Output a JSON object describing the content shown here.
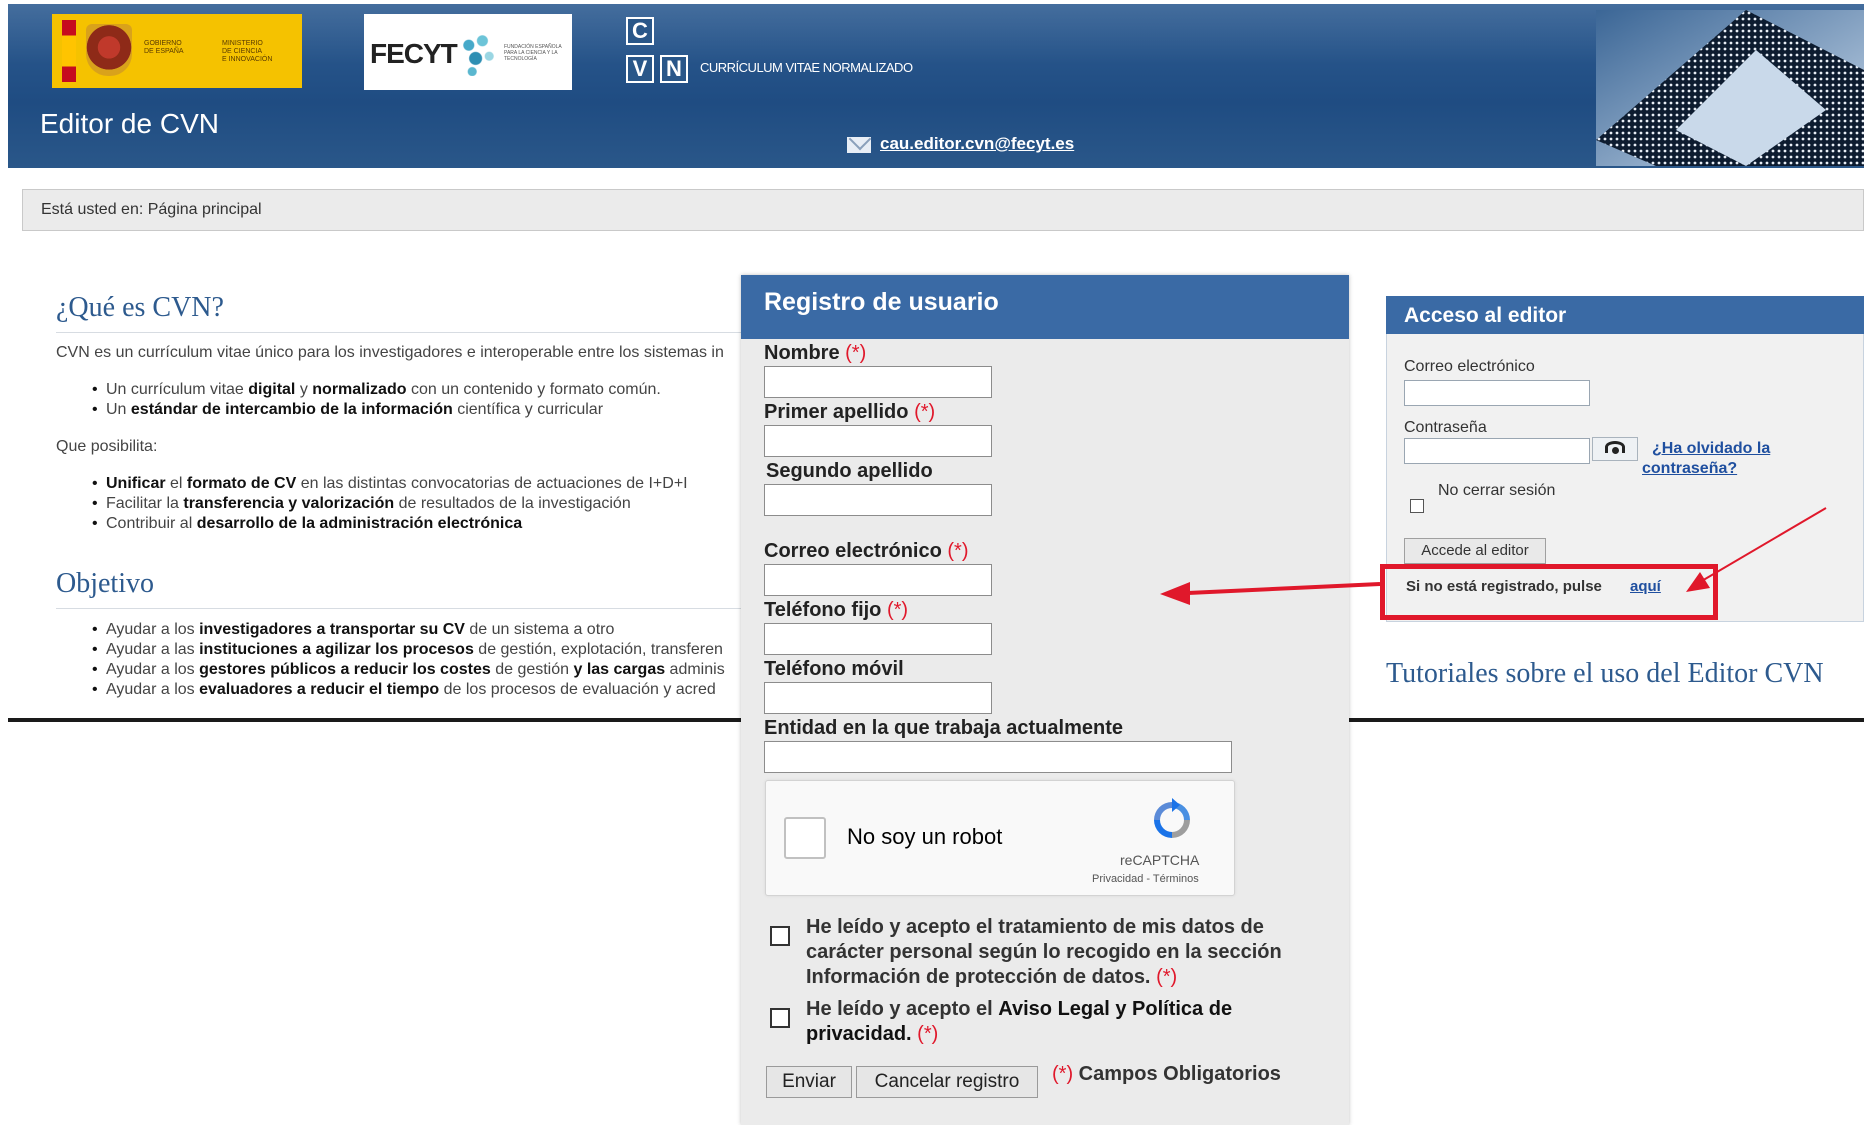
{
  "header": {
    "gov_logo_line1": "GOBIERNO\nDE ESPAÑA",
    "gov_logo_line2": "MINISTERIO\nDE CIENCIA\nE INNOVACIÓN",
    "fecyt_word": "FECYT",
    "fecyt_sub": "FUNDACIÓN ESPAÑOLA PARA LA CIENCIA Y LA TECNOLOGÍA",
    "cvn_letters": [
      "C",
      "V",
      "N"
    ],
    "cvn_text": "CURRÍCULUM VITAE NORMALIZADO",
    "app_title": "Editor de CVN",
    "contact_email": "cau.editor.cvn@fecyt.es"
  },
  "breadcrumb": "Está usted en: Página principal",
  "what_is": {
    "heading": "¿Qué es CVN?",
    "intro": "CVN es un currículum vitae único para los investigadores e interoperable entre los sistemas in",
    "bullets": [
      [
        "Un currículum vitae ",
        "digital",
        " y ",
        "normalizado",
        " con un contenido y formato común."
      ],
      [
        "Un ",
        "estándar de intercambio de la información",
        " científica y curricular"
      ]
    ],
    "possible_label": "Que posibilita:",
    "possible_bullets": [
      [
        "",
        "Unificar",
        " el ",
        "formato de CV",
        " en las distintas convocatorias de actuaciones de I+D+I"
      ],
      [
        "Facilitar la ",
        "transferencia y valorización",
        " de resultados de la investigación"
      ],
      [
        "Contribuir al ",
        "desarrollo de la administración electrónica",
        ""
      ]
    ]
  },
  "objective": {
    "heading": "Objetivo",
    "bullets": [
      [
        "Ayudar a los ",
        "investigadores a transportar su CV",
        " de un sistema a otro"
      ],
      [
        "Ayudar a las ",
        "instituciones a agilizar los procesos",
        " de gestión, explotación, transferen"
      ],
      [
        "Ayudar a los ",
        "gestores públicos a reducir los costes",
        " de gestión ",
        "y las cargas",
        " adminis"
      ],
      [
        "Ayudar a los ",
        "evaluadores a reducir el tiempo",
        " de los procesos de evaluación y acred"
      ]
    ]
  },
  "access": {
    "title": "Acceso al editor",
    "email_label": "Correo electrónico",
    "password_label": "Contraseña",
    "forgot_line1": "¿Ha olvidado la",
    "forgot_line2": "contraseña?",
    "keep_session": "No cerrar sesión",
    "access_button": "Accede al editor",
    "not_registered": "Si no está registrado, pulse",
    "here_link": "aquí"
  },
  "tutorials_heading": "Tutoriales sobre el uso del Editor CVN",
  "registration": {
    "title": "Registro de usuario",
    "required_mark": "(*)",
    "fields": {
      "nombre": "Nombre",
      "primer_apellido": "Primer apellido",
      "segundo_apellido": "Segundo apellido",
      "correo": "Correo electrónico",
      "telefono_fijo": "Teléfono fijo",
      "telefono_movil": "Teléfono móvil",
      "entidad": "Entidad en la que trabaja actualmente"
    },
    "values": {
      "nombre": "",
      "primer_apellido": "",
      "segundo_apellido": "",
      "correo": "",
      "telefono_fijo": "",
      "telefono_movil": "",
      "entidad": ""
    },
    "captcha": {
      "label": "No soy un robot",
      "brand": "reCAPTCHA",
      "links": "Privacidad - Términos"
    },
    "consent_data": [
      "He leído y acepto el tratamiento de mis datos de",
      "carácter personal según lo recogido en la sección",
      "Información de protección de datos."
    ],
    "consent_legal_pre": "He leído y acepto el ",
    "consent_legal_bold": "Aviso Legal y Política de",
    "consent_legal_line2": "privacidad.",
    "submit_button": "Enviar",
    "cancel_button": "Cancelar registro",
    "required_note": "Campos Obligatorios"
  },
  "colors": {
    "header_blue": "#2a5789",
    "panel_blue": "#3a6aa5",
    "heading_blue": "#2d5a8e",
    "required_red": "#e0182b",
    "link_blue": "#1f4f9f"
  }
}
